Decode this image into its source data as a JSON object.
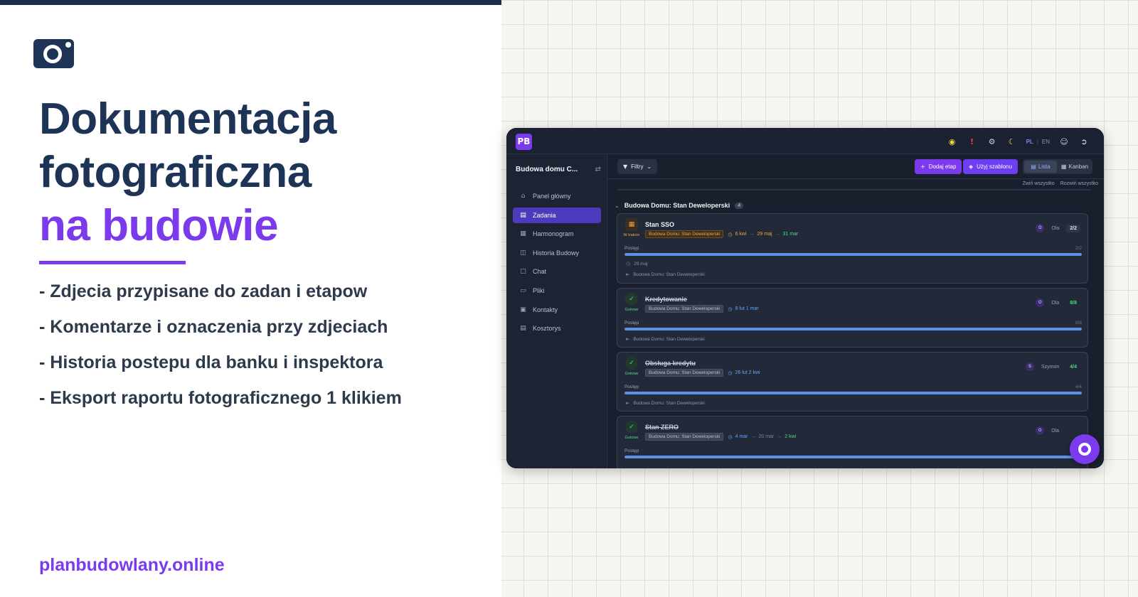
{
  "promo": {
    "title_line1": "Dokumentacja",
    "title_line2": "fotograficzna",
    "title_line3": "na budowie",
    "bullets": [
      "- Zdjecia przypisane do zadan i etapow",
      "- Komentarze i oznaczenia przy zdjeciach",
      "- Historia postepu dla banku i inspektora",
      "- Eksport raportu fotograficznego 1 klikiem"
    ],
    "website": "planbudowlany.online",
    "icon": "camera-icon",
    "accent_color": "#7c3aed",
    "title_color": "#1e3457"
  },
  "app": {
    "logo_text": "PB",
    "top_icons": [
      "lightbulb-icon",
      "alert-icon",
      "gear-icon",
      "moon-icon",
      "user-icon",
      "logout-icon"
    ],
    "alert_glyph": "!",
    "lang_active": "PL",
    "lang_other": "EN",
    "lang_sep": "|",
    "project_name": "Budowa domu C...",
    "nav": [
      {
        "label": "Panel główny",
        "icon": "home-icon",
        "active": false
      },
      {
        "label": "Zadania",
        "icon": "clipboard-icon",
        "active": true
      },
      {
        "label": "Harmonogram",
        "icon": "calendar-icon",
        "active": false
      },
      {
        "label": "Historia Budowy",
        "icon": "book-icon",
        "active": false
      },
      {
        "label": "Chat",
        "icon": "chat-icon",
        "active": false
      },
      {
        "label": "Pliki",
        "icon": "folder-icon",
        "active": false
      },
      {
        "label": "Kontakty",
        "icon": "contacts-icon",
        "active": false
      },
      {
        "label": "Kosztorys",
        "icon": "receipt-icon",
        "active": false
      }
    ],
    "toolbar": {
      "filter_label": "Filtry",
      "add_label": "Dodaj etap",
      "template_label": "Użyj szablonu",
      "view_list": "Lista",
      "view_kanban": "Kanban",
      "collapse_all": "Zwiń wszystko",
      "expand_all": "Rozwiń wszystko"
    },
    "group": {
      "title": "Budowa Domu: Stan Deweloperski",
      "count": "4"
    },
    "tasks": [
      {
        "title": "Stan SSO",
        "status": "W trakcie",
        "done": false,
        "tag": "Budowa Domu: Stan Deweloperski",
        "date1": "6 kwi",
        "date2": "29 maj",
        "date3": "31 mar",
        "assignee_initial": "O",
        "assignee": "Ola",
        "count": "2/2",
        "progress_label": "Postęp",
        "progress_value": "2/2",
        "progress": 1.0,
        "due": "29 maj",
        "footer": "Budowa Domu: Stan Deweloperski"
      },
      {
        "title": "Kredytowanie",
        "status": "Gotowe",
        "done": true,
        "tag": "Budowa Domu: Stan Deweloperski",
        "date1": "8 lut 1 mar",
        "assignee_initial": "O",
        "assignee": "Ola",
        "count": "8/8",
        "progress_label": "Postęp",
        "progress_value": "8/8",
        "progress": 1.0,
        "footer": "Budowa Domu: Stan Deweloperski"
      },
      {
        "title": "Obsługa kredytu",
        "status": "Gotowe",
        "done": true,
        "tag": "Budowa Domu: Stan Deweloperski",
        "date1": "26 lut 2 kwi",
        "assignee_initial": "S",
        "assignee": "Szymon",
        "count": "4/4",
        "progress_label": "Postęp",
        "progress_value": "4/4",
        "progress": 1.0,
        "footer": "Budowa Domu: Stan Deweloperski"
      },
      {
        "title": "Stan ZERO",
        "status": "Gotowe",
        "done": true,
        "tag": "Budowa Domu: Stan Deweloperski",
        "date1": "4 mar",
        "date2": "20 mar",
        "date3": "2 kwi",
        "assignee_initial": "O",
        "assignee": "Ola",
        "progress_label": "Postęp",
        "progress": 1.0
      }
    ],
    "fab_icon": "chat-bubble-icon"
  }
}
